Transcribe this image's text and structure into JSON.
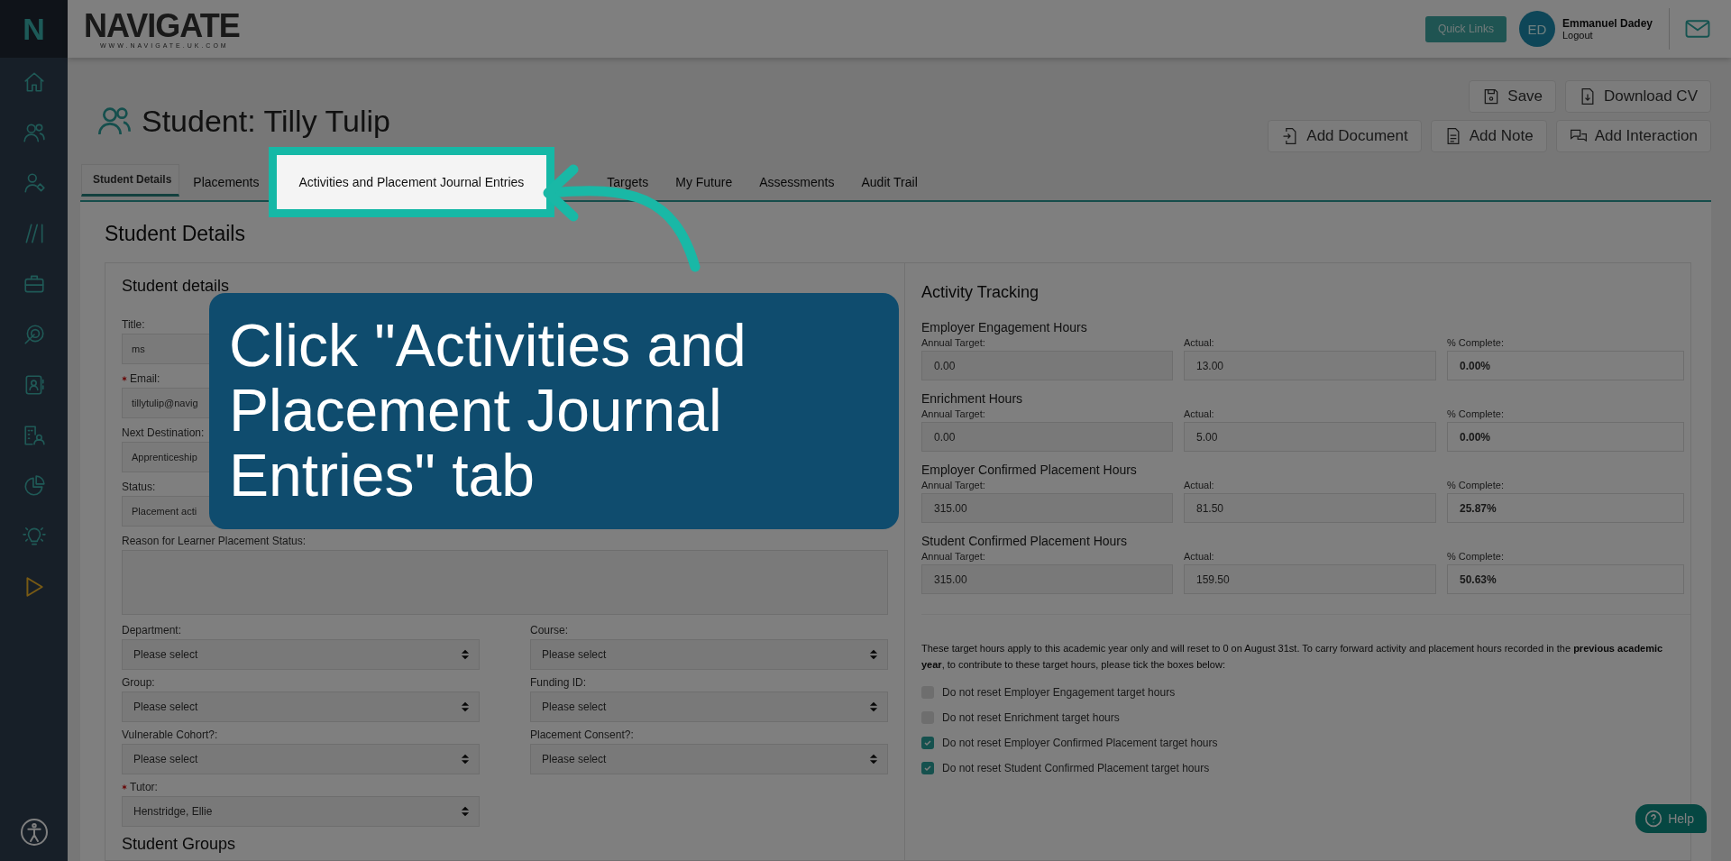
{
  "sidebar": {
    "logo": "N",
    "items": [
      {
        "kind": "home"
      },
      {
        "kind": "people"
      },
      {
        "kind": "person-tag"
      },
      {
        "kind": "slashes"
      },
      {
        "kind": "briefcase"
      },
      {
        "kind": "target"
      },
      {
        "kind": "contact"
      },
      {
        "kind": "building"
      },
      {
        "kind": "pie"
      },
      {
        "kind": "bulb"
      },
      {
        "kind": "play"
      }
    ],
    "footer": {
      "kind": "accessibility"
    }
  },
  "header": {
    "logo": "NAVIGATE",
    "logo_url": "WWW.NAVIGATE.UK.COM",
    "quick_links": "Quick Links",
    "user": {
      "initials": "ED",
      "name": "Emmanuel Dadey",
      "logout": "Logout"
    }
  },
  "page_title": "Student: Tilly Tulip",
  "actions": [
    [
      {
        "kind": "save",
        "label": "Save"
      },
      {
        "kind": "download",
        "label": "Download CV"
      }
    ],
    [
      {
        "kind": "document",
        "label": "Add Document"
      },
      {
        "kind": "note",
        "label": "Add Note"
      },
      {
        "kind": "chat",
        "label": "Add Interaction"
      }
    ]
  ],
  "tabs": [
    {
      "label": "Student Details",
      "selected": true,
      "highlighted": false
    },
    {
      "label": "Placements",
      "selected": false,
      "highlighted": false
    },
    {
      "label": "Activities and Placement Journal Entries",
      "selected": false,
      "highlighted": true
    },
    {
      "label": "Targets",
      "selected": false,
      "highlighted": false
    },
    {
      "label": "My Future",
      "selected": false,
      "highlighted": false
    },
    {
      "label": "Assessments",
      "selected": false,
      "highlighted": false
    },
    {
      "label": "Audit Trail",
      "selected": false,
      "highlighted": false
    }
  ],
  "section_title": "Student Details",
  "student_details": {
    "title": "Student details",
    "fields": [
      {
        "label": "Title:",
        "value": "ms",
        "required": false
      },
      {
        "label": "Email:",
        "value": "tillytulip@navig",
        "required": true
      },
      {
        "label": "Next Destination:",
        "value": "Apprenticeship",
        "required": false
      },
      {
        "label": "Status:",
        "value": "Placement acti",
        "required": false
      }
    ],
    "reason": {
      "label": "Reason for Learner Placement Status:"
    },
    "selects": [
      {
        "label": "Department:",
        "value": "Please select",
        "required": false
      },
      {
        "label": "Course:",
        "value": "Please select",
        "required": false
      },
      {
        "label": "Group:",
        "value": "Please select",
        "required": false
      },
      {
        "label": "Funding ID:",
        "value": "Please select",
        "required": false
      },
      {
        "label": "Vulnerable Cohort?:",
        "value": "Please select",
        "required": false
      },
      {
        "label": "Placement Consent?:",
        "value": "Please select",
        "required": false
      },
      {
        "label": "Tutor:",
        "value": "Henstridge, Ellie",
        "required": true
      }
    ],
    "subheading": "Student Groups"
  },
  "activity_tracking": {
    "title": "Activity Tracking",
    "groups": [
      {
        "name": "Employer Engagement Hours",
        "fields": [
          {
            "kind": "target",
            "label": "Annual Target:",
            "value": "0.00"
          },
          {
            "kind": "actual",
            "label": "Actual:",
            "value": "13.00"
          },
          {
            "kind": "percent",
            "label": "% Complete:",
            "value": "0.00%"
          }
        ]
      },
      {
        "name": "Enrichment Hours",
        "fields": [
          {
            "kind": "target",
            "label": "Annual Target:",
            "value": "0.00"
          },
          {
            "kind": "actual",
            "label": "Actual:",
            "value": "5.00"
          },
          {
            "kind": "percent",
            "label": "% Complete:",
            "value": "0.00%"
          }
        ]
      },
      {
        "name": "Employer Confirmed Placement Hours",
        "fields": [
          {
            "kind": "target",
            "label": "Annual Target:",
            "value": "315.00"
          },
          {
            "kind": "actual",
            "label": "Actual:",
            "value": "81.50"
          },
          {
            "kind": "percent",
            "label": "% Complete:",
            "value": "25.87%"
          }
        ]
      },
      {
        "name": "Student Confirmed Placement Hours",
        "fields": [
          {
            "kind": "target",
            "label": "Annual Target:",
            "value": "315.00"
          },
          {
            "kind": "actual",
            "label": "Actual:",
            "value": "159.50"
          },
          {
            "kind": "percent",
            "label": "% Complete:",
            "value": "50.63%"
          }
        ]
      }
    ],
    "note": "These target hours apply to this academic year only and will reset to 0 on August 31st. To carry forward activity and placement hours recorded in the **previous academic year**, to contribute to these target hours, please tick the boxes below:",
    "checkboxes": [
      {
        "label": "Do not reset Employer Engagement target hours",
        "checked": false
      },
      {
        "label": "Do not reset Enrichment target hours",
        "checked": false
      },
      {
        "label": "Do not reset Employer Confirmed Placement target hours",
        "checked": true
      },
      {
        "label": "Do not reset Student Confirmed Placement target hours",
        "checked": true
      }
    ]
  },
  "help": "Help",
  "callout": {
    "text": "Click \"Activities and Placement Journal Entries\" tab"
  }
}
